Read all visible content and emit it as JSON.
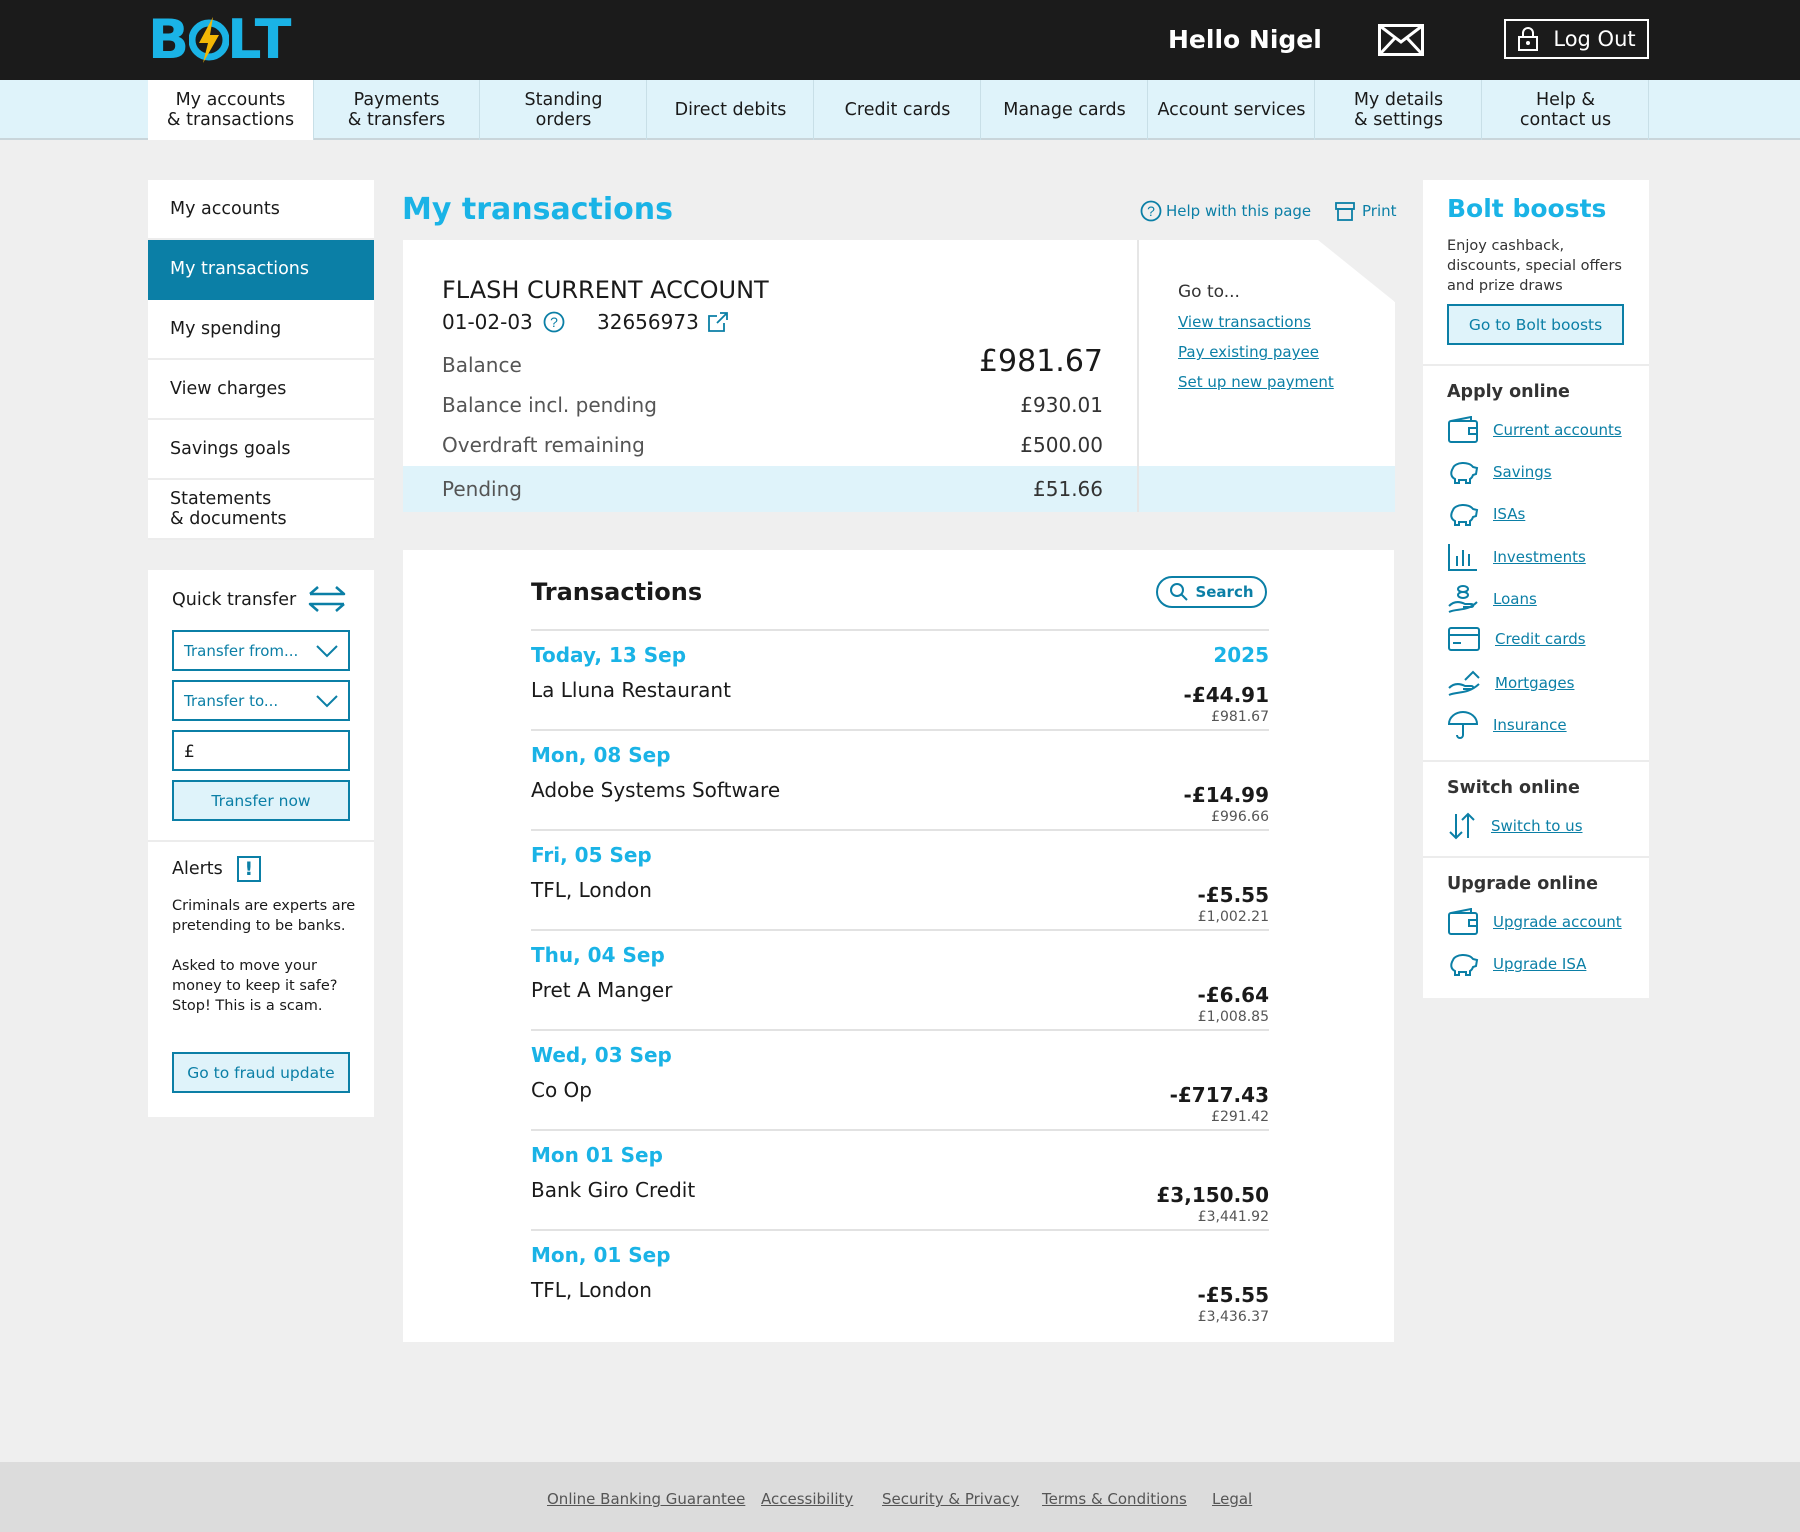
{
  "header": {
    "brand": "BOLT",
    "greeting": "Hello Nigel",
    "logout_label": "Log Out"
  },
  "nav": [
    "My accounts\n& transactions",
    "Payments\n& transfers",
    "Standing\norders",
    "Direct debits",
    "Credit cards",
    "Manage cards",
    "Account services",
    "My details\n& settings",
    "Help &\ncontact us"
  ],
  "left_nav": [
    "My accounts",
    "My transactions",
    "My spending",
    "View charges",
    "Savings goals",
    "Statements\n& documents"
  ],
  "quick_transfer": {
    "title": "Quick transfer",
    "from_placeholder": "Transfer from...",
    "to_placeholder": "Transfer to...",
    "currency": "£",
    "button": "Transfer now"
  },
  "alerts": {
    "title": "Alerts",
    "text": "Criminals are experts are pretending to be banks.\n\nAsked to move your money to keep it safe? Stop! This is a scam.",
    "button": "Go to fraud  update"
  },
  "page": {
    "title": "My transactions",
    "help": "Help with this page",
    "print": "Print"
  },
  "account": {
    "name": "FLASH CURRENT ACCOUNT",
    "sort_code": "01-02-03",
    "number": "32656973",
    "balance_label": "Balance",
    "balance": "£981.67",
    "pending_incl_label": "Balance incl. pending",
    "pending_incl": "£930.01",
    "overdraft_label": "Overdraft remaining",
    "overdraft": "£500.00",
    "pending_label": "Pending",
    "pending": "£51.66",
    "goto_title": "Go to...",
    "goto_links": [
      "View transactions",
      "Pay existing payee",
      "Set up new payment"
    ]
  },
  "transactions": {
    "title": "Transactions",
    "search_label": "Search",
    "year": "2025",
    "rows": [
      {
        "date": "Today, 13 Sep",
        "merchant": "La Lluna Restaurant",
        "amount": "-£44.91",
        "balance": "£981.67"
      },
      {
        "date": "Mon, 08 Sep",
        "merchant": "Adobe Systems Software",
        "amount": "-£14.99",
        "balance": "£996.66"
      },
      {
        "date": "Fri, 05 Sep",
        "merchant": "TFL, London",
        "amount": "-£5.55",
        "balance": "£1,002.21"
      },
      {
        "date": "Thu, 04  Sep",
        "merchant": "Pret A Manger",
        "amount": "-£6.64",
        "balance": "£1,008.85"
      },
      {
        "date": "Wed, 03  Sep",
        "merchant": "Co Op",
        "amount": "-£717.43",
        "balance": "£291.42"
      },
      {
        "date": "Mon 01  Sep",
        "merchant": "Bank Giro Credit",
        "amount": "£3,150.50",
        "balance": "£3,441.92"
      },
      {
        "date": "Mon, 01  Sep",
        "merchant": "TFL, London",
        "amount": "-£5.55",
        "balance": "£3,436.37"
      }
    ]
  },
  "sidebar": {
    "boosts_title": "Bolt boosts",
    "boosts_desc": "Enjoy cashback, discounts, special offers and prize draws",
    "boosts_button": "Go to Bolt boosts",
    "apply_title": "Apply online",
    "apply_links": [
      {
        "label": "Current accounts",
        "icon": "wallet-icon"
      },
      {
        "label": "Savings",
        "icon": "piggy-bank-icon"
      },
      {
        "label": "ISAs",
        "icon": "piggy-bank-icon"
      },
      {
        "label": "Investments",
        "icon": "bar-chart-icon"
      },
      {
        "label": "Loans",
        "icon": "hand-coins-icon"
      },
      {
        "label": "Credit cards",
        "icon": "credit-card-icon"
      },
      {
        "label": "Mortgages",
        "icon": "hand-house-icon"
      },
      {
        "label": "Insurance",
        "icon": "umbrella-icon"
      }
    ],
    "switch_title": "Switch online",
    "switch_link": "Switch to us",
    "upgrade_title": "Upgrade online",
    "upgrade_links": [
      "Upgrade account",
      "Upgrade ISA"
    ]
  },
  "footer": [
    "Online Banking Guarantee",
    "Accessibility",
    "Security & Privacy",
    "Terms & Conditions",
    "Legal"
  ],
  "colors": {
    "accent": "#1ab3e6",
    "primary": "#0b7fa6",
    "light": "#dff3fa",
    "dark": "#1b1b1b"
  }
}
